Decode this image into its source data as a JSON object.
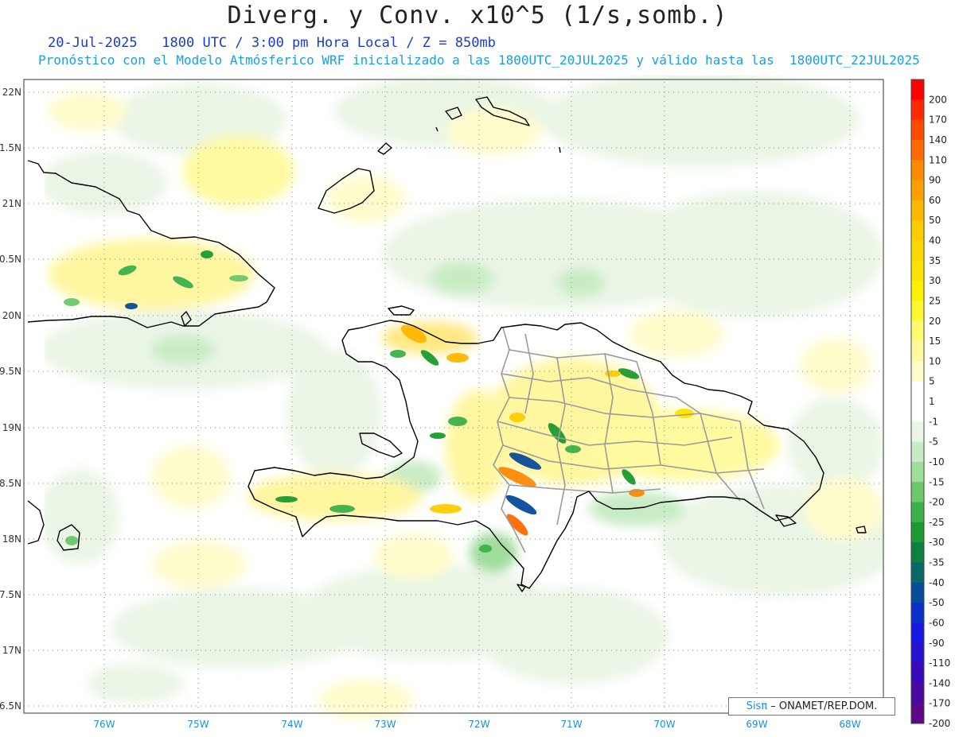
{
  "header": {
    "title": "Diverg. y Conv. x10^5 (1/s,somb.)",
    "line1": "20-Jul-2025   1800 UTC / 3:00 pm Hora Local / Z = 850mb",
    "line2": "Pronóstico con el Modelo Atmósferico WRF inicializado a las 1800UTC_20JUL2025 y válido hasta las  1800UTC_22JUL2025"
  },
  "map": {
    "lat_labels": [
      "22N",
      "1.5N",
      "21N",
      "0.5N",
      "20N",
      "9.5N",
      "19N",
      "8.5N",
      "18N",
      "7.5N",
      "17N",
      "6.5N"
    ],
    "lon_labels": [
      "76W",
      "75W",
      "74W",
      "73W",
      "72W",
      "71W",
      "70W",
      "69W",
      "68W"
    ],
    "lon_label_color": "#1a8fe0"
  },
  "legend": {
    "levels": [
      "200",
      "170",
      "140",
      "110",
      "90",
      "60",
      "50",
      "40",
      "35",
      "30",
      "25",
      "20",
      "15",
      "10",
      "5",
      "1",
      "-1",
      "-5",
      "-10",
      "-15",
      "-20",
      "-25",
      "-30",
      "-35",
      "-40",
      "-50",
      "-60",
      "-90",
      "-110",
      "-140",
      "-170",
      "-200"
    ],
    "colors": [
      "#ff0000",
      "#ff2a00",
      "#ff4a00",
      "#ff6a00",
      "#ff8a00",
      "#ffa000",
      "#ffb800",
      "#ffcc00",
      "#ffd800",
      "#ffe400",
      "#fff000",
      "#fff830",
      "#fffa70",
      "#fffaa0",
      "#fffccc",
      "#ffffff",
      "#ffffff",
      "#eaf5e6",
      "#c8ebc4",
      "#a0dc9c",
      "#6cc86a",
      "#3cb04a",
      "#1a9a30",
      "#0e8040",
      "#0a6868",
      "#0a4a9a",
      "#0a30c8",
      "#1818e0",
      "#2a10d0",
      "#3a0ab8",
      "#4a0aa0",
      "#5a0a88"
    ]
  },
  "credit": {
    "brand": "Sisπ",
    "text": " – ONAMET/REP.DOM."
  }
}
